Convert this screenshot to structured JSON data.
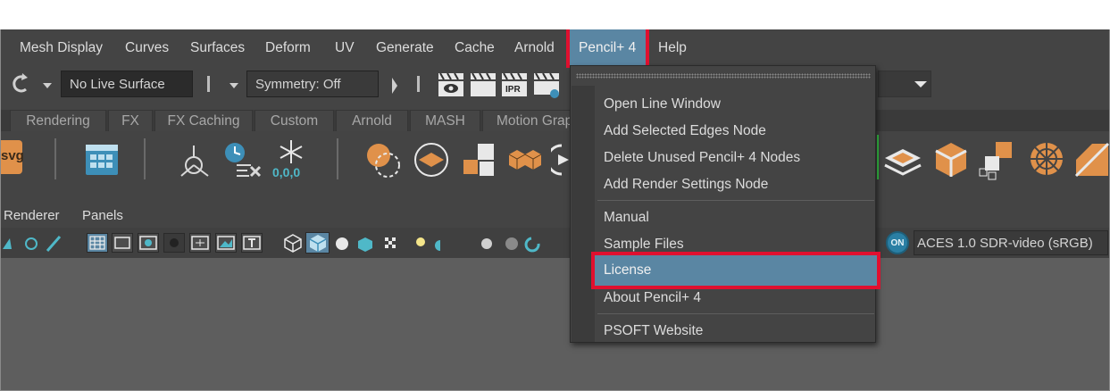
{
  "menubar": {
    "items": [
      "Mesh Display",
      "Curves",
      "Surfaces",
      "Deform",
      "UV",
      "Generate",
      "Cache",
      "Arnold",
      "Pencil+ 4",
      "Help"
    ],
    "active": "Pencil+ 4"
  },
  "statusline": {
    "live_surface": "No Live Surface",
    "symmetry": "Symmetry: Off",
    "ipr_label": "IPR"
  },
  "shelf_tabs": [
    "Rendering",
    "FX",
    "FX Caching",
    "Custom",
    "Arnold",
    "MASH",
    "Motion Graphics"
  ],
  "shelf": {
    "svg_label": "svg",
    "coords_label": "0,0,0"
  },
  "panel_menu": [
    "Renderer",
    "Panels"
  ],
  "panel_toolbar": {
    "on_label": "ON",
    "color_space": "ACES 1.0 SDR-video (sRGB)"
  },
  "pencil_menu": {
    "items": [
      {
        "label": "Open Line Window",
        "group": 1
      },
      {
        "label": "Add Selected Edges Node",
        "group": 1
      },
      {
        "label": "Delete Unused Pencil+ 4 Nodes",
        "group": 1
      },
      {
        "label": "Add Render Settings Node",
        "group": 1
      },
      {
        "label": "Manual",
        "group": 2
      },
      {
        "label": "Sample Files",
        "group": 2
      },
      {
        "label": "License",
        "group": 2
      },
      {
        "label": "About Pencil+ 4",
        "group": 2
      },
      {
        "label": "PSOFT Website",
        "group": 3
      }
    ],
    "highlighted": "License"
  },
  "colors": {
    "accent_blue": "#5a86a3",
    "highlight_red": "#e0102f",
    "orange_icon": "#e0914a",
    "teal_icon": "#4fb8c8"
  }
}
